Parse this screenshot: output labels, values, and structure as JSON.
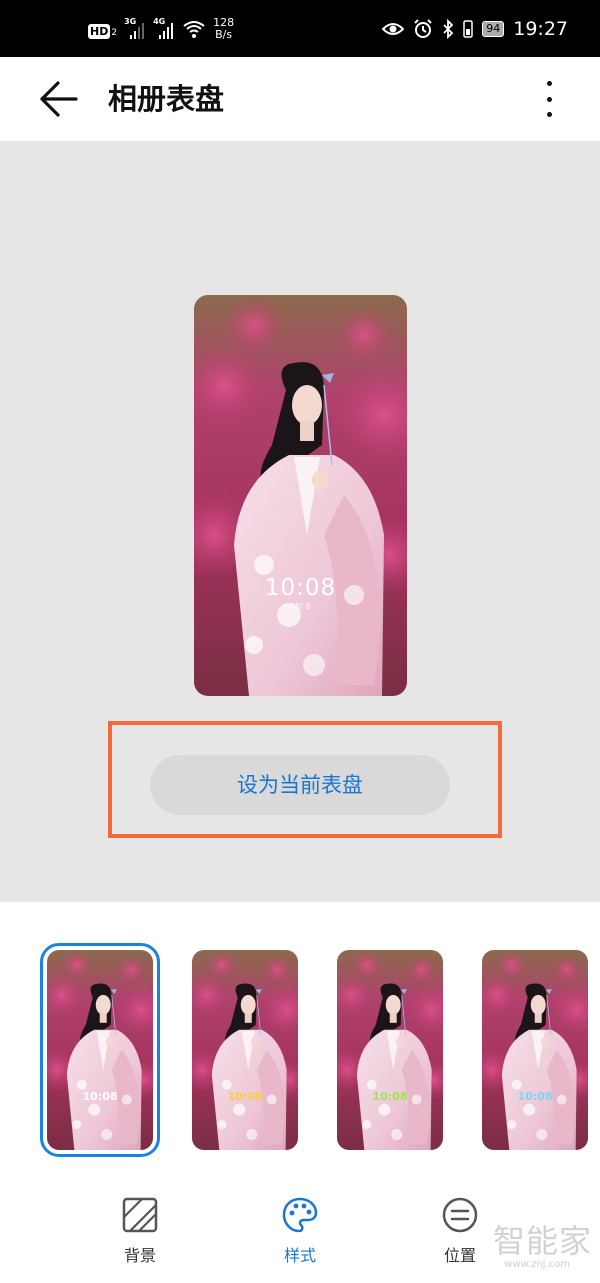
{
  "status_bar": {
    "hd": "HD",
    "hd_sub": "2",
    "network_1": "3G",
    "network_2": "4G",
    "speed_value": "128",
    "speed_unit": "B/s",
    "battery": "94",
    "time": "19:27",
    "icons": [
      "eye-icon",
      "alarm-icon",
      "bluetooth-icon",
      "battery-icon",
      "wifi-icon"
    ]
  },
  "header": {
    "title": "相册表盘",
    "back_icon": "arrow-left-icon",
    "more_icon": "more-vertical-icon"
  },
  "preview": {
    "clock": "10:08",
    "date": "FRI 8"
  },
  "set_button_label": "设为当前表盘",
  "styles": [
    {
      "clock": "10:08",
      "color": "#ffffff",
      "selected": true
    },
    {
      "clock": "10:08",
      "color": "#f5d23c",
      "selected": false
    },
    {
      "clock": "10:08",
      "color": "#9be84a",
      "selected": false
    },
    {
      "clock": "10:08",
      "color": "#7fd3f0",
      "selected": false
    }
  ],
  "tabs": [
    {
      "label": "背景",
      "icon": "background-icon",
      "active": false
    },
    {
      "label": "样式",
      "icon": "palette-icon",
      "active": true
    },
    {
      "label": "位置",
      "icon": "position-icon",
      "active": false
    }
  ],
  "watermark": {
    "text": "智能家",
    "url": "www.znj.com"
  },
  "colors": {
    "accent": "#1a76d2",
    "highlight": "#f56a3a",
    "preview_bg": "#e6e6e6",
    "button_bg": "#d9d9d9"
  }
}
